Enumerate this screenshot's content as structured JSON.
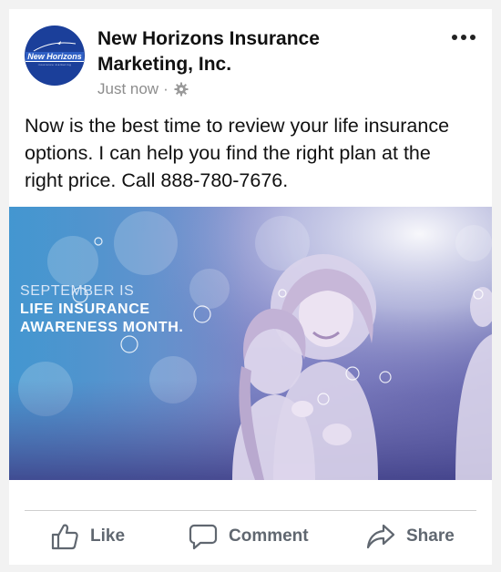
{
  "post": {
    "page_name": "New Horizons Insurance Marketing, Inc.",
    "timestamp": "Just now",
    "separator": "·",
    "audience_icon": "gear-icon",
    "text": "Now is the best time to review your life insurance options. I can help you find the right plan at the right price. Call 888-780-7676.",
    "avatar": {
      "logo_text": "New Horizons",
      "logo_subtext": "insurance marketing",
      "background": "#1b3f9a"
    }
  },
  "image": {
    "line1": "SEPTEMBER IS",
    "line2": "LIFE INSURANCE",
    "line3": "AWARENESS MONTH.",
    "tint": "#6f7fc0"
  },
  "actions": {
    "like": {
      "label": "Like",
      "icon": "thumbs-up-icon"
    },
    "comment": {
      "label": "Comment",
      "icon": "speech-bubble-icon"
    },
    "share": {
      "label": "Share",
      "icon": "share-arrow-icon"
    }
  },
  "colors": {
    "action_text": "#606770",
    "meta_text": "#8d8d8d"
  }
}
